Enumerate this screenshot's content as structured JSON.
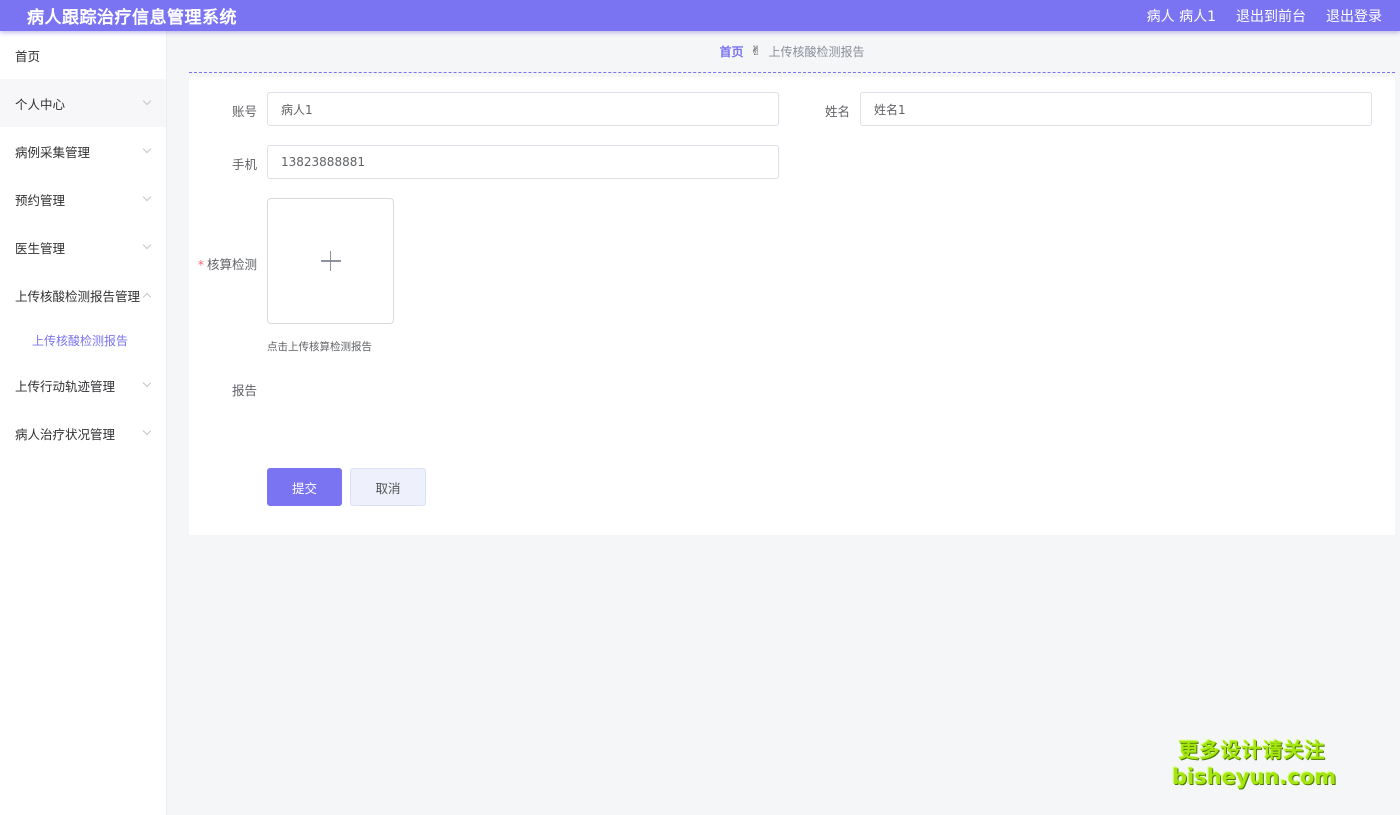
{
  "header": {
    "app_title": "病人跟踪治疗信息管理系统",
    "user_label": "病人 病人1",
    "front_link": "退出到前台",
    "logout_link": "退出登录",
    "accent_color": "#7b74f2"
  },
  "sidebar": {
    "items": [
      {
        "label": "首页"
      },
      {
        "label": "个人中心"
      },
      {
        "label": "病例采集管理"
      },
      {
        "label": "预约管理"
      },
      {
        "label": "医生管理"
      },
      {
        "label": "上传核酸检测报告管理"
      },
      {
        "label": "上传行动轨迹管理"
      },
      {
        "label": "病人治疗状况管理"
      }
    ],
    "active_submenu": {
      "label": "上传核酸检测报告"
    }
  },
  "breadcrumb": {
    "home": "首页",
    "separator_icon": "hand-icon",
    "separator": "✌",
    "current": "上传核酸检测报告"
  },
  "form": {
    "account": {
      "label": "账号",
      "value": "病人1"
    },
    "name": {
      "label": "姓名",
      "value": "姓名1"
    },
    "phone": {
      "label": "手机",
      "value": "13823888881"
    },
    "test": {
      "required_mark": "*",
      "label": "核算检测",
      "upload_tip": "点击上传核算检测报告",
      "upload_icon": "plus-icon"
    },
    "report": {
      "label": "报告"
    },
    "submit_label": "提交",
    "cancel_label": "取消"
  },
  "watermark": {
    "line1": "更多设计请关注",
    "line2": "bisheyun.com"
  }
}
